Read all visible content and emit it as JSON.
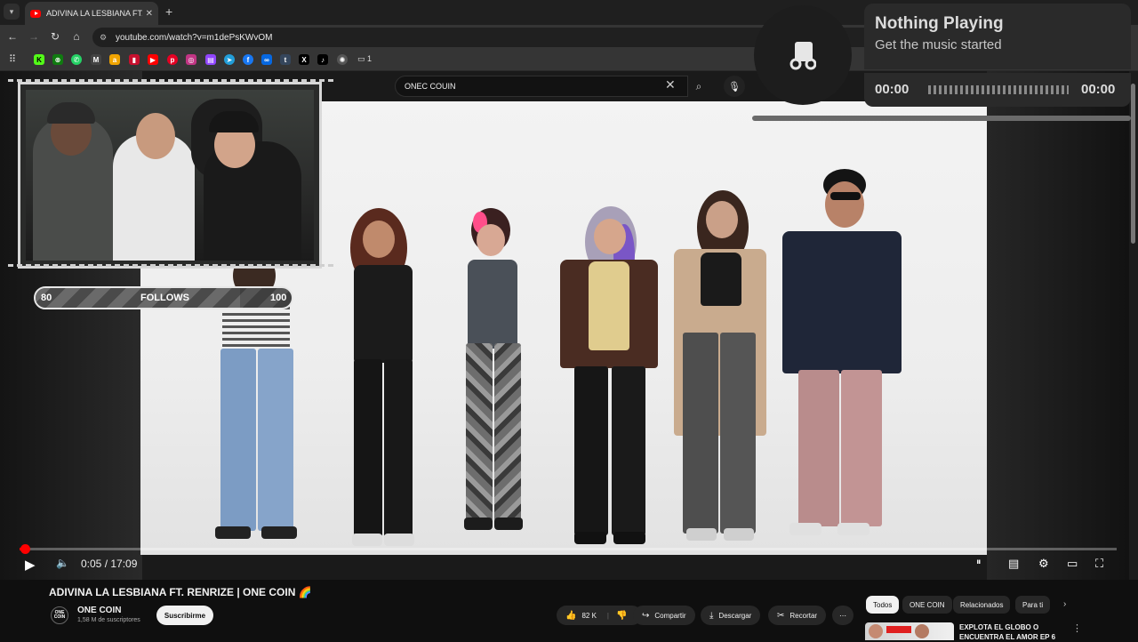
{
  "browser": {
    "tab_title": "ADIVINA LA LESBIANA FT. RENRIZE | ONE COIN",
    "url": "youtube.com/watch?v=m1dePsKWvOM",
    "bookmark_folder_label": "1",
    "bookmark_icons": [
      "kick-icon",
      "xbox-icon",
      "whatsapp-icon",
      "gmail-icon",
      "amazon-icon",
      "pinterest-red-icon",
      "youtube-icon",
      "pinterest-icon",
      "instagram-icon",
      "twitch-icon",
      "telegram-icon",
      "facebook-icon",
      "meta-icon",
      "tumblr-icon",
      "x-icon",
      "tiktok-icon",
      "chatgpt-icon"
    ]
  },
  "youtube": {
    "search_query": "ONEC COUIN",
    "video": {
      "title": "ADIVINA LA LESBIANA FT. RENRIZE | ONE COIN 🌈",
      "current_time": "0:05",
      "time_separator": " / ",
      "duration": "17:09",
      "progress_fraction": 0.005
    },
    "channel": {
      "name": "ONE COIN",
      "avatar_text": "ONE COIN",
      "subscribers": "1,58 M de suscriptores",
      "subscribe_label": "Suscribirme"
    },
    "actions": {
      "likes": "82 K",
      "share": "Compartir",
      "download": "Descargar",
      "clip": "Recortar",
      "more": "⋯"
    },
    "chips": [
      "Todos",
      "ONE COIN",
      "Relacionados",
      "Para ti"
    ],
    "related": {
      "title": "EXPLOTA EL GLOBO O ENCUENTRA EL AMOR EP 6"
    }
  },
  "overlay": {
    "follows": {
      "current": "80",
      "label": "FOLLOWS",
      "goal": "100",
      "fraction": 0.8
    }
  },
  "music_widget": {
    "title": "Nothing Playing",
    "subtitle": "Get the music started",
    "elapsed": "00:00",
    "total": "00:00"
  },
  "colors": {
    "accent": "#ff0000",
    "background": "#0f0f0f"
  }
}
